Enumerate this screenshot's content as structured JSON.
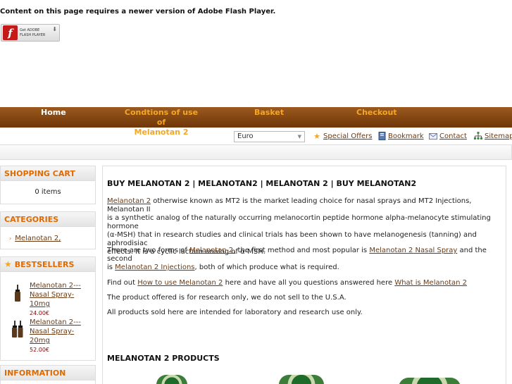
{
  "flash": {
    "message": "Content on this page requires a newer version of Adobe Flash Player.",
    "badge_line1": "Get ADOBE",
    "badge_line2": "FLASH PLAYER"
  },
  "nav": {
    "home": "Home",
    "conditions_line1": "Condtions of use of",
    "conditions_line2": "Melanotan 2",
    "basket": "Basket",
    "checkout": "Checkout"
  },
  "topbar": {
    "currency": "Euro",
    "special_offers": "Special Offers",
    "bookmark": "Bookmark",
    "contact": "Contact",
    "sitemap": "Sitemap"
  },
  "sidebar": {
    "cart_title": "SHOPPING CART",
    "cart_items": "0 items",
    "categories_title": "CATEGORIES",
    "category_1": "Melanotan 2,",
    "bestsellers_title": "BESTSELLERS",
    "bestsellers": [
      {
        "line1": "Melanotan 2---",
        "line2": "Nasal Spray-",
        "line3": "10mg",
        "price": "24.00€"
      },
      {
        "line1": "Melanotan 2---",
        "line2": "Nasal Spray-",
        "line3": "20mg",
        "price": "52.00€"
      }
    ],
    "information_title": "INFORMATION"
  },
  "main": {
    "heading": "BUY MELANOTAN 2 | MELANOTAN2 | MELANOTAN 2 | BUY MELANOTAN2",
    "p1_link": "Melanotan 2",
    "p1_line1": " otherwise known as MT2 is the market leading choice for nasal sprays and MT2 Injections, Melanotan II",
    "p1_line2": "is a synthetic analog of the naturally occurring melanocortin peptide hormone alpha-melanocyte stimulating hormone",
    "p1_line3": "(α-MSH) that in research studies and clinical trials has been shown to have melanogenesis (tanning) and aphrodisiac",
    "p1_line4": "effects. It is a cyclic lactam analog of α-MSH.",
    "p2_a": "There are two forms of  ",
    "p2_link1": "Melanotan 2,",
    "p2_b": " the first method and most popular is ",
    "p2_link2": "Melanotan 2 Nasal Spray",
    "p2_c": " and the second",
    "p2_d": "is ",
    "p2_link3": "Melanotan 2 Injections",
    "p2_e": ", both of which produce what is required.",
    "p3_a": "Find out ",
    "p3_link1": "How to use Melanotan 2",
    "p3_b": " here and have all you questions answered here ",
    "p3_link2": "What is Melanotan 2",
    "p4": "The product offered is for research only, we do not sell to the U.S.A.",
    "p5": "All products sold here are intended for laboratory and research use only.",
    "products_heading": "MELANOTAN 2 PRODUCTS"
  }
}
